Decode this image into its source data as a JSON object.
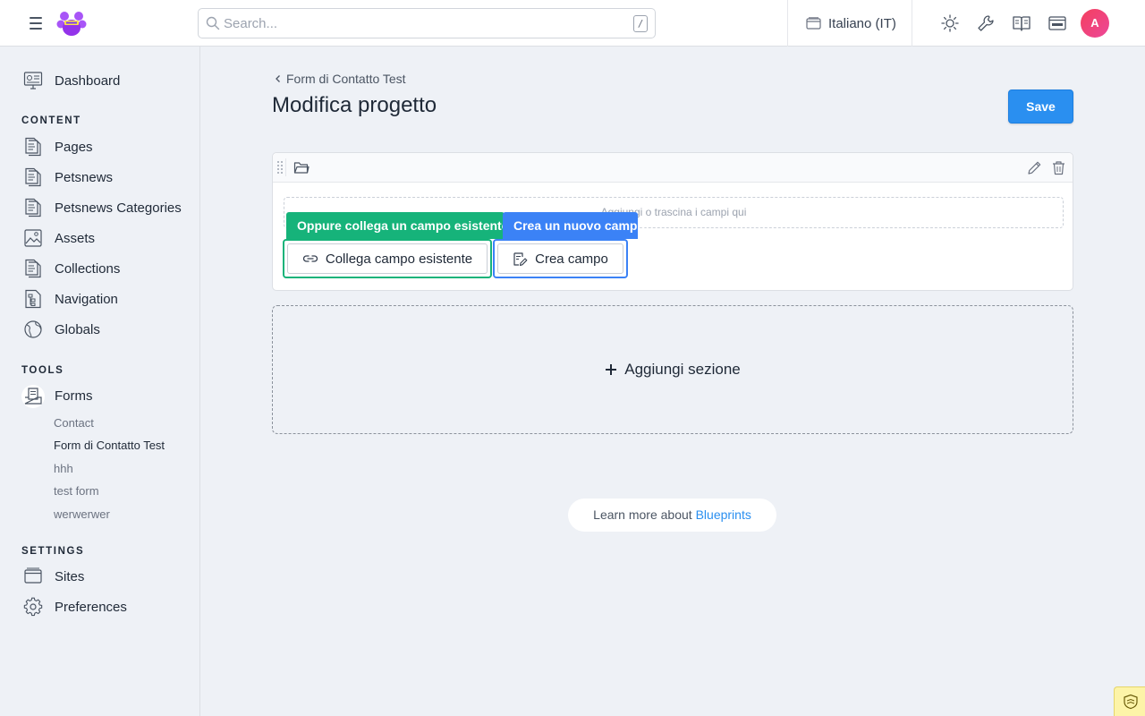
{
  "header": {
    "menu_icon": "hamburger-icon",
    "logo_icon": "paw-logo-icon",
    "search": {
      "placeholder": "Search...",
      "shortcut": "/"
    },
    "site": {
      "label": "Italiano (IT)",
      "icon": "sites-icon"
    },
    "icons": [
      "sun-icon",
      "wrench-icon",
      "book-icon",
      "domain-icon"
    ],
    "avatar_initial": "A",
    "avatar_color": "#ec4899"
  },
  "sidebar": {
    "dashboard": "Dashboard",
    "content_title": "CONTENT",
    "content_items": [
      {
        "label": "Pages",
        "icon": "pages-icon"
      },
      {
        "label": "Petsnews",
        "icon": "collection-icon"
      },
      {
        "label": "Petsnews Categories",
        "icon": "collection-icon"
      },
      {
        "label": "Assets",
        "icon": "assets-icon"
      },
      {
        "label": "Collections",
        "icon": "collections-icon"
      },
      {
        "label": "Navigation",
        "icon": "navigation-icon"
      },
      {
        "label": "Globals",
        "icon": "globe-icon"
      }
    ],
    "tools_title": "TOOLS",
    "forms_label": "Forms",
    "forms_children": [
      "Contact",
      "Form di Contatto Test",
      "hhh",
      "test form",
      "werwerwer"
    ],
    "forms_active_child": "Form di Contatto Test",
    "settings_title": "SETTINGS",
    "settings_items": [
      {
        "label": "Sites",
        "icon": "sites-icon"
      },
      {
        "label": "Preferences",
        "icon": "gear-icon"
      }
    ]
  },
  "main": {
    "breadcrumb": "Form di Contatto Test",
    "title": "Modifica progetto",
    "save_label": "Save",
    "section": {
      "drop_hint": "Aggiungi o trascina i campi qui",
      "tip_link": "Oppure collega un campo esistente",
      "tip_new": "Crea un nuovo campo",
      "link_button": "Collega campo esistente",
      "new_button": "Crea campo"
    },
    "add_section": "Aggiungi sezione",
    "learn_prefix": "Learn more about",
    "learn_link": "Blueprints"
  },
  "colors": {
    "primary": "#2a8ff0",
    "green_highlight": "#16b37a",
    "blue_highlight": "#3b82f6",
    "background": "#eef1f6"
  }
}
